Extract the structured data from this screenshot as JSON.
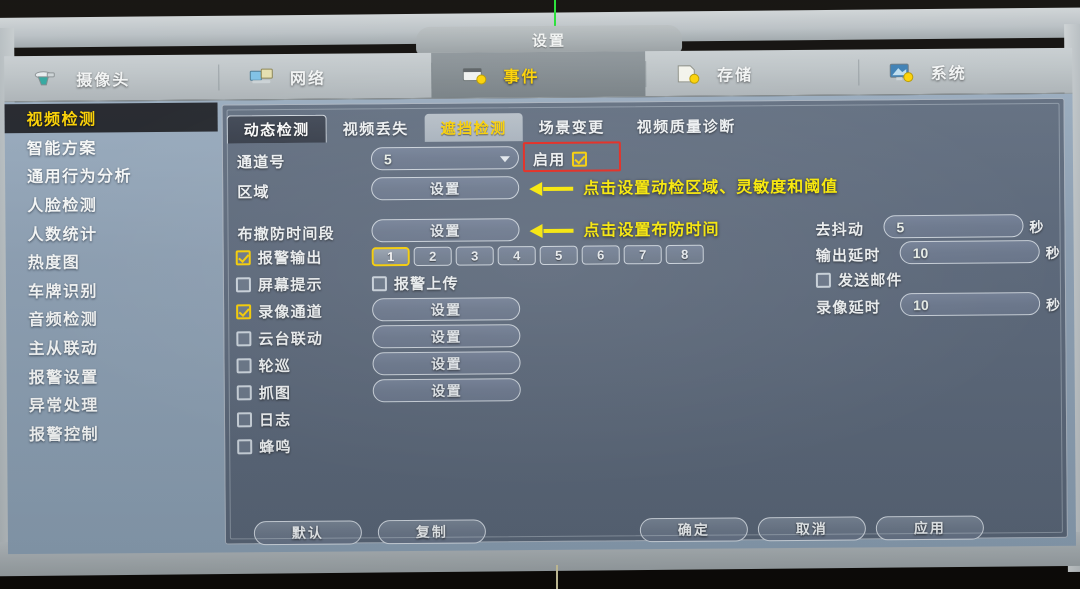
{
  "window": {
    "title": "设置"
  },
  "menu": {
    "items": [
      {
        "label": "摄像头",
        "icon": "camera-icon",
        "active": false
      },
      {
        "label": "网络",
        "icon": "network-icon",
        "active": false
      },
      {
        "label": "事件",
        "icon": "event-icon",
        "active": true
      },
      {
        "label": "存储",
        "icon": "storage-icon",
        "active": false
      },
      {
        "label": "系统",
        "icon": "system-icon",
        "active": false
      }
    ]
  },
  "sidebar": {
    "items": [
      {
        "label": "视频检测",
        "active": true
      },
      {
        "label": "智能方案",
        "active": false
      },
      {
        "label": "通用行为分析",
        "active": false
      },
      {
        "label": "人脸检测",
        "active": false
      },
      {
        "label": "人数统计",
        "active": false
      },
      {
        "label": "热度图",
        "active": false
      },
      {
        "label": "车牌识别",
        "active": false
      },
      {
        "label": "音频检测",
        "active": false
      },
      {
        "label": "主从联动",
        "active": false
      },
      {
        "label": "报警设置",
        "active": false
      },
      {
        "label": "异常处理",
        "active": false
      },
      {
        "label": "报警控制",
        "active": false
      }
    ]
  },
  "tabs": [
    {
      "label": "动态检测",
      "state": "active"
    },
    {
      "label": "视频丢失",
      "state": "normal"
    },
    {
      "label": "遮挡检测",
      "state": "hover"
    },
    {
      "label": "场景变更",
      "state": "normal"
    },
    {
      "label": "视频质量诊断",
      "state": "normal"
    }
  ],
  "form": {
    "channel_label": "通道号",
    "channel_value": "5",
    "enable_label": "启用",
    "enable_checked": true,
    "region_label": "区域",
    "region_button": "设置",
    "schedule_label": "布撤防时间段",
    "schedule_button": "设置",
    "alarm_out_label": "报警输出",
    "alarm_out_checked": true,
    "alarm_out_numbers": [
      "1",
      "2",
      "3",
      "4",
      "5",
      "6",
      "7",
      "8"
    ],
    "alarm_out_selected": "1",
    "screen_tip_label": "屏幕提示",
    "alarm_upload_label": "报警上传",
    "record_channel_label": "录像通道",
    "record_channel_button": "设置",
    "ptz_link_label": "云台联动",
    "ptz_link_button": "设置",
    "tour_label": "轮巡",
    "tour_button": "设置",
    "snapshot_label": "抓图",
    "snapshot_button": "设置",
    "log_label": "日志",
    "buzzer_label": "蜂鸣",
    "debounce_label": "去抖动",
    "debounce_value": "5",
    "debounce_unit": "秒",
    "out_delay_label": "输出延时",
    "out_delay_value": "10",
    "out_delay_unit": "秒",
    "send_mail_label": "发送邮件",
    "rec_delay_label": "录像延时",
    "rec_delay_value": "10",
    "rec_delay_unit": "秒"
  },
  "annotations": [
    {
      "text": "点击设置动检区域、灵敏度和阈值"
    },
    {
      "text": "点击设置布防时间"
    }
  ],
  "footer": {
    "left": [
      {
        "label": "默认"
      },
      {
        "label": "复制"
      }
    ],
    "right": [
      {
        "label": "确定"
      },
      {
        "label": "取消"
      },
      {
        "label": "应用"
      }
    ]
  },
  "colors": {
    "accent_yellow": "#ffd400",
    "annotation_yellow": "#ffee00",
    "annotation_red": "#e8261c",
    "panel_bg": "#5d6a7d",
    "sidebar_bg": "#8fa2b6",
    "menu_bg": "#bfc6c9"
  }
}
